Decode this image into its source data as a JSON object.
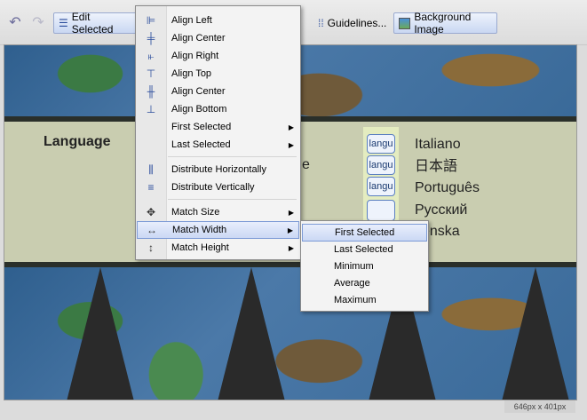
{
  "toolbar": {
    "undo_icon": "undo-icon",
    "redo_icon": "redo-icon",
    "edit_selected": "Edit Selected",
    "guidelines": "Guidelines...",
    "background_image": "Background Image"
  },
  "canvas": {
    "language_heading": "Language",
    "fragment": "e",
    "button_labels": [
      "langu",
      "langu",
      "langu",
      ""
    ],
    "languages": [
      "Italiano",
      "日本語",
      "Português",
      "Русский",
      "venska"
    ]
  },
  "edit_menu": {
    "items": [
      {
        "label": "Align Left",
        "icon": "align-left-icon"
      },
      {
        "label": "Align Center",
        "icon": "align-center-horizontal-icon"
      },
      {
        "label": "Align Right",
        "icon": "align-right-icon"
      },
      {
        "label": "Align Top",
        "icon": "align-top-icon"
      },
      {
        "label": "Align Center",
        "icon": "align-center-vertical-icon"
      },
      {
        "label": "Align Bottom",
        "icon": "align-bottom-icon"
      },
      {
        "label": "First Selected"
      },
      {
        "label": "Last Selected"
      },
      {
        "label": "Distribute Horizontally",
        "icon": "distribute-horizontal-icon"
      },
      {
        "label": "Distribute Vertically",
        "icon": "distribute-vertical-icon"
      },
      {
        "label": "Match Size",
        "icon": "match-size-icon"
      },
      {
        "label": "Match Width",
        "icon": "match-width-icon"
      },
      {
        "label": "Match Height",
        "icon": "match-height-icon"
      }
    ]
  },
  "match_width_submenu": {
    "items": [
      "First Selected",
      "Last Selected",
      "Minimum",
      "Average",
      "Maximum"
    ]
  },
  "status": {
    "size": "646px x 401px"
  },
  "colors": {
    "accent": "#c9d7f2",
    "panel": "#c9cdb0",
    "menu_bg": "#f3f3f3"
  }
}
